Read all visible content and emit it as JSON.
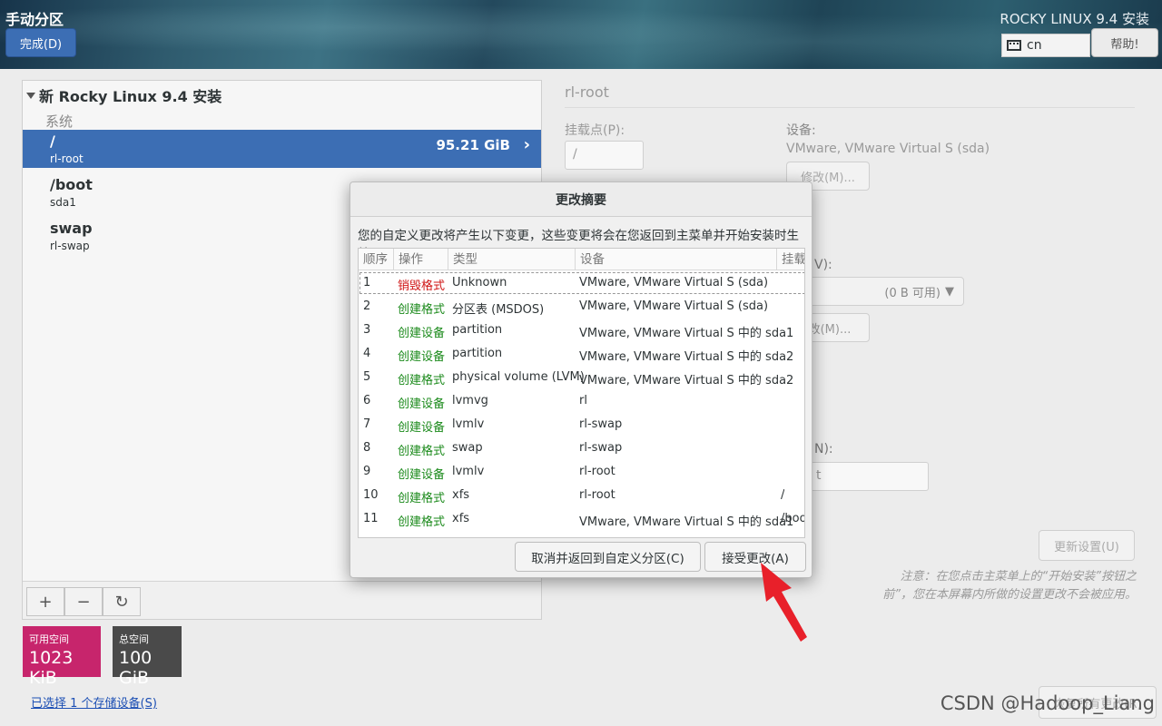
{
  "header": {
    "page_title": "手动分区",
    "done_label": "完成(D)",
    "product_title": "ROCKY LINUX 9.4 安装",
    "keyboard_layout": "cn",
    "help_label": "帮助!"
  },
  "left": {
    "tree_title": "新 Rocky Linux 9.4 安装",
    "group_label": "系统",
    "mounts": [
      {
        "mountpoint": "/",
        "device": "rl-root",
        "size": "95.21 GiB"
      },
      {
        "mountpoint": "/boot",
        "device": "sda1"
      },
      {
        "mountpoint": "swap",
        "device": "rl-swap"
      }
    ],
    "tools": {
      "add": "+",
      "remove": "−",
      "refresh": "↻"
    }
  },
  "space": {
    "available_label": "可用空间",
    "available_value": "1023 KiB",
    "total_label": "总空间",
    "total_value": "100 GiB",
    "available_color": "#c7256c",
    "total_color": "#4a4a4a"
  },
  "storage_link": "已选择 1 个存储设备(S)",
  "right": {
    "title": "rl-root",
    "mountpoint_label": "挂载点(P):",
    "mountpoint_value": "/",
    "device_label": "设备:",
    "device_value": "VMware, VMware Virtual S (sda)",
    "modify_label": "修改(M)...",
    "volume_label_partial": "V):",
    "dropdown_value": "(0 B 可用)",
    "modify2_label": "改(M)...",
    "name_label_partial": "N):",
    "name_value_partial": "t",
    "update_label": "更新设置(U)",
    "note": "注意：在您点击主菜单上的“开始安装”按钮之前”，您在本屏幕内所做的设置更改不会被应用。",
    "reset_label": "恢复所有更改(R)"
  },
  "dialog": {
    "title": "更改摘要",
    "message": "您的自定义更改将产生以下变更，这些变更将会在您返回到主菜单并开始安装时生效：",
    "columns": [
      "顺序",
      "操作",
      "类型",
      "设备",
      "挂载"
    ],
    "rows": [
      {
        "order": "1",
        "action": "销毁格式",
        "type": "Unknown",
        "device": "VMware, VMware Virtual S (sda)",
        "mount": "",
        "destructive": true
      },
      {
        "order": "2",
        "action": "创建格式",
        "type": "分区表 (MSDOS)",
        "device": "VMware, VMware Virtual S (sda)",
        "mount": ""
      },
      {
        "order": "3",
        "action": "创建设备",
        "type": "partition",
        "device": "VMware, VMware Virtual S 中的 sda1",
        "mount": ""
      },
      {
        "order": "4",
        "action": "创建设备",
        "type": "partition",
        "device": "VMware, VMware Virtual S 中的 sda2",
        "mount": ""
      },
      {
        "order": "5",
        "action": "创建格式",
        "type": "physical volume (LVM)",
        "device": "VMware, VMware Virtual S 中的 sda2",
        "mount": ""
      },
      {
        "order": "6",
        "action": "创建设备",
        "type": "lvmvg",
        "device": "rl",
        "mount": ""
      },
      {
        "order": "7",
        "action": "创建设备",
        "type": "lvmlv",
        "device": "rl-swap",
        "mount": ""
      },
      {
        "order": "8",
        "action": "创建格式",
        "type": "swap",
        "device": "rl-swap",
        "mount": ""
      },
      {
        "order": "9",
        "action": "创建设备",
        "type": "lvmlv",
        "device": "rl-root",
        "mount": ""
      },
      {
        "order": "10",
        "action": "创建格式",
        "type": "xfs",
        "device": "rl-root",
        "mount": "/"
      },
      {
        "order": "11",
        "action": "创建格式",
        "type": "xfs",
        "device": "VMware, VMware Virtual S 中的 sda1",
        "mount": "/boo"
      }
    ],
    "cancel_label": "取消并返回到自定义分区(C)",
    "accept_label": "接受更改(A)"
  },
  "watermark": "CSDN @Hadoop_Liang",
  "colors": {
    "accent": "#3c6eb4",
    "destructive": "#d01616",
    "create": "#1b8a1b",
    "arrow": "#e8202a"
  }
}
